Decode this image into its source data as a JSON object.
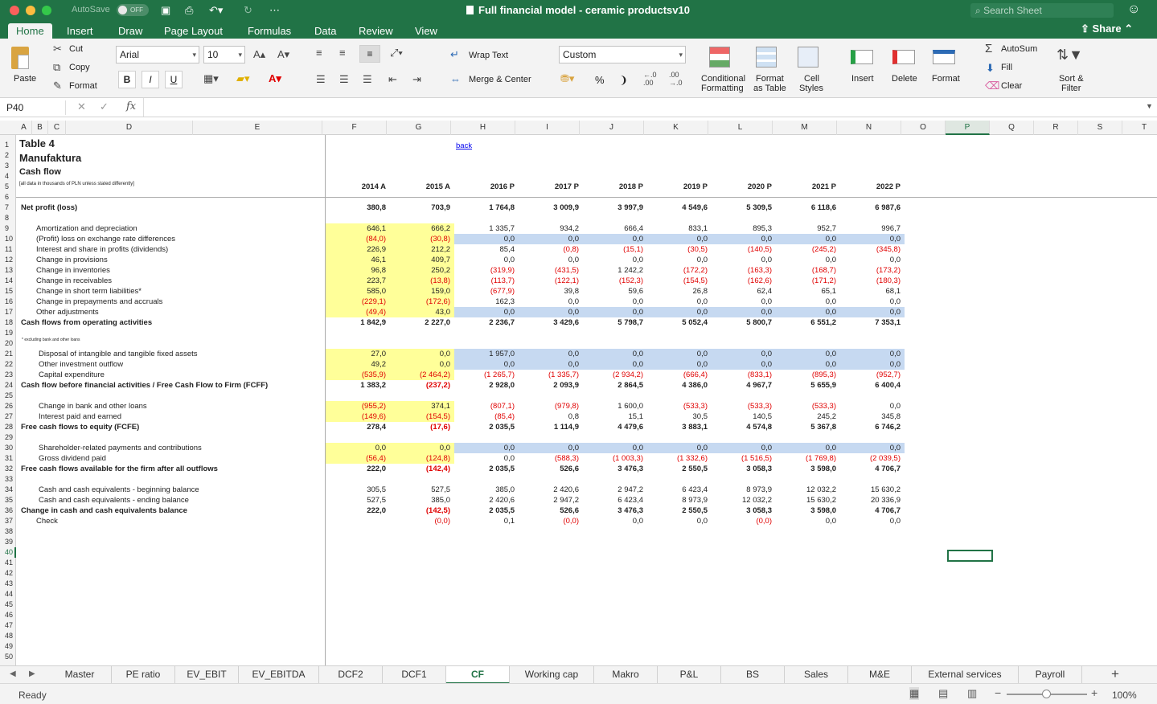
{
  "titlebar": {
    "autosave": "AutoSave",
    "autosave_state": "OFF",
    "doc_title": "Full financial model - ceramic productsv10",
    "search_placeholder": "Search Sheet"
  },
  "ribbon_tabs": [
    "Home",
    "Insert",
    "Draw",
    "Page Layout",
    "Formulas",
    "Data",
    "Review",
    "View"
  ],
  "share": "Share",
  "ribbon": {
    "paste": "Paste",
    "cut": "Cut",
    "copy": "Copy",
    "format_painter": "Format",
    "font_name": "Arial",
    "font_size": "10",
    "bold": "B",
    "italic": "I",
    "underline": "U",
    "wrap_text": "Wrap Text",
    "merge_center": "Merge & Center",
    "number_format": "Custom",
    "percent": "%",
    "comma": "❩",
    "cond_fmt_1": "Conditional",
    "cond_fmt_2": "Formatting",
    "fmt_table_1": "Format",
    "fmt_table_2": "as Table",
    "cell_styles_1": "Cell",
    "cell_styles_2": "Styles",
    "insert": "Insert",
    "delete": "Delete",
    "format": "Format",
    "autosum": "AutoSum",
    "fill": "Fill",
    "clear": "Clear",
    "sort_1": "Sort &",
    "sort_2": "Filter"
  },
  "formula_bar": {
    "name_box": "P40",
    "fx": "fx",
    "value": ""
  },
  "columns": [
    "A",
    "B",
    "C",
    "D",
    "E",
    "F",
    "G",
    "H",
    "I",
    "J",
    "K",
    "L",
    "M",
    "N",
    "O",
    "P",
    "Q",
    "R",
    "S",
    "T"
  ],
  "rows": [
    "1",
    "2",
    "3",
    "4",
    "5",
    "6",
    "7",
    "8",
    "9",
    "10",
    "11",
    "12",
    "13",
    "14",
    "15",
    "16",
    "17",
    "18",
    "19",
    "20",
    "21",
    "22",
    "23",
    "24",
    "25",
    "26",
    "27",
    "28",
    "29",
    "30",
    "31",
    "32",
    "33",
    "34",
    "35",
    "36",
    "37",
    "38",
    "39",
    "40",
    "41",
    "42",
    "43",
    "44",
    "45",
    "46",
    "47",
    "48",
    "49",
    "50"
  ],
  "sheet": {
    "title1": "Table 4",
    "title2": "Manufaktura",
    "title3": "Cash flow",
    "subnote": "[all data in thousands of PLN unless stated differently]",
    "back_link": "back",
    "footnote": "* excluding bank and other loans",
    "years": [
      "2014 A",
      "2015 A",
      "2016 P",
      "2017 P",
      "2018 P",
      "2019 P",
      "2020 P",
      "2021 P",
      "2022 P"
    ],
    "lines": [
      {
        "row": 7,
        "label": "Net profit (loss)",
        "bold": true,
        "indent": 0,
        "values": [
          "380,8",
          "703,9",
          "1 764,8",
          "3 009,9",
          "3 997,9",
          "4 549,6",
          "5 309,5",
          "6 118,6",
          "6 987,6"
        ]
      },
      {
        "row": 9,
        "label": "Amortization and depreciation",
        "indent": 1,
        "values": [
          "646,1",
          "666,2",
          "1 335,7",
          "934,2",
          "666,4",
          "833,1",
          "895,3",
          "952,7",
          "996,7"
        ]
      },
      {
        "row": 10,
        "label": "(Profit) loss on exchange rate differences",
        "indent": 1,
        "values": [
          "(84,0)",
          "(30,8)",
          "0,0",
          "0,0",
          "0,0",
          "0,0",
          "0,0",
          "0,0",
          "0,0"
        ]
      },
      {
        "row": 11,
        "label": "Interest and share in profits (dividends)",
        "indent": 1,
        "values": [
          "226,9",
          "212,2",
          "85,4",
          "(0,8)",
          "(15,1)",
          "(30,5)",
          "(140,5)",
          "(245,2)",
          "(345,8)"
        ]
      },
      {
        "row": 12,
        "label": "Change in provisions",
        "indent": 1,
        "values": [
          "46,1",
          "409,7",
          "0,0",
          "0,0",
          "0,0",
          "0,0",
          "0,0",
          "0,0",
          "0,0"
        ]
      },
      {
        "row": 13,
        "label": "Change in inventories",
        "indent": 1,
        "values": [
          "96,8",
          "250,2",
          "(319,9)",
          "(431,5)",
          "1 242,2",
          "(172,2)",
          "(163,3)",
          "(168,7)",
          "(173,2)"
        ]
      },
      {
        "row": 14,
        "label": "Change in receivables",
        "indent": 1,
        "values": [
          "223,7",
          "(13,8)",
          "(113,7)",
          "(122,1)",
          "(152,3)",
          "(154,5)",
          "(162,6)",
          "(171,2)",
          "(180,3)"
        ]
      },
      {
        "row": 15,
        "label": "Change in short term liabilities*",
        "indent": 1,
        "values": [
          "585,0",
          "159,0",
          "(677,9)",
          "39,8",
          "59,6",
          "26,8",
          "62,4",
          "65,1",
          "68,1"
        ]
      },
      {
        "row": 16,
        "label": "Change in prepayments and accruals",
        "indent": 1,
        "values": [
          "(229,1)",
          "(172,6)",
          "162,3",
          "0,0",
          "0,0",
          "0,0",
          "0,0",
          "0,0",
          "0,0"
        ]
      },
      {
        "row": 17,
        "label": "Other adjustments",
        "indent": 1,
        "values": [
          "(49,4)",
          "43,0",
          "0,0",
          "0,0",
          "0,0",
          "0,0",
          "0,0",
          "0,0",
          "0,0"
        ]
      },
      {
        "row": 18,
        "label": "Cash flows from operating activities",
        "bold": true,
        "indent": 0,
        "values": [
          "1 842,9",
          "2 227,0",
          "2 236,7",
          "3 429,6",
          "5 798,7",
          "5 052,4",
          "5 800,7",
          "6 551,2",
          "7 353,1"
        ]
      },
      {
        "row": 21,
        "label": "Disposal of intangible and tangible fixed assets",
        "indent": 2,
        "values": [
          "27,0",
          "0,0",
          "1 957,0",
          "0,0",
          "0,0",
          "0,0",
          "0,0",
          "0,0",
          "0,0"
        ]
      },
      {
        "row": 22,
        "label": "Other investment outflow",
        "indent": 2,
        "values": [
          "49,2",
          "0,0",
          "0,0",
          "0,0",
          "0,0",
          "0,0",
          "0,0",
          "0,0",
          "0,0"
        ]
      },
      {
        "row": 23,
        "label": "Capital expenditure",
        "indent": 2,
        "values": [
          "(535,9)",
          "(2 464,2)",
          "(1 265,7)",
          "(1 335,7)",
          "(2 934,2)",
          "(666,4)",
          "(833,1)",
          "(895,3)",
          "(952,7)"
        ]
      },
      {
        "row": 24,
        "label": "Cash flow before financial activities / Free Cash Flow to Firm (FCFF)",
        "bold": true,
        "indent": 0,
        "values": [
          "1 383,2",
          "(237,2)",
          "2 928,0",
          "2 093,9",
          "2 864,5",
          "4 386,0",
          "4 967,7",
          "5 655,9",
          "6 400,4"
        ]
      },
      {
        "row": 26,
        "label": "Change in bank and other loans",
        "indent": 2,
        "values": [
          "(955,2)",
          "374,1",
          "(807,1)",
          "(979,8)",
          "1 600,0",
          "(533,3)",
          "(533,3)",
          "(533,3)",
          "0,0"
        ]
      },
      {
        "row": 27,
        "label": "Interest paid and earned",
        "indent": 2,
        "values": [
          "(149,6)",
          "(154,5)",
          "(85,4)",
          "0,8",
          "15,1",
          "30,5",
          "140,5",
          "245,2",
          "345,8"
        ]
      },
      {
        "row": 28,
        "label": "Free cash flows to equity (FCFE)",
        "bold": true,
        "indent": 0,
        "values": [
          "278,4",
          "(17,6)",
          "2 035,5",
          "1 114,9",
          "4 479,6",
          "3 883,1",
          "4 574,8",
          "5 367,8",
          "6 746,2"
        ]
      },
      {
        "row": 30,
        "label": "Shareholder-related payments and contributions",
        "indent": 2,
        "values": [
          "0,0",
          "0,0",
          "0,0",
          "0,0",
          "0,0",
          "0,0",
          "0,0",
          "0,0",
          "0,0"
        ]
      },
      {
        "row": 31,
        "label": "Gross dividend paid",
        "indent": 2,
        "values": [
          "(56,4)",
          "(124,8)",
          "0,0",
          "(588,3)",
          "(1 003,3)",
          "(1 332,6)",
          "(1 516,5)",
          "(1 769,8)",
          "(2 039,5)"
        ]
      },
      {
        "row": 32,
        "label": "Free cash flows available for the firm after all outflows",
        "bold": true,
        "indent": 0,
        "values": [
          "222,0",
          "(142,4)",
          "2 035,5",
          "526,6",
          "3 476,3",
          "2 550,5",
          "3 058,3",
          "3 598,0",
          "4 706,7"
        ]
      },
      {
        "row": 34,
        "label": "Cash and cash equivalents - beginning balance",
        "indent": 2,
        "values": [
          "305,5",
          "527,5",
          "385,0",
          "2 420,6",
          "2 947,2",
          "6 423,4",
          "8 973,9",
          "12 032,2",
          "15 630,2"
        ]
      },
      {
        "row": 35,
        "label": "Cash and cash equivalents - ending balance",
        "indent": 2,
        "values": [
          "527,5",
          "385,0",
          "2 420,6",
          "2 947,2",
          "6 423,4",
          "8 973,9",
          "12 032,2",
          "15 630,2",
          "20 336,9"
        ]
      },
      {
        "row": 36,
        "label": "Change in cash and cash equivalents balance",
        "bold": true,
        "indent": 0,
        "values": [
          "222,0",
          "(142,5)",
          "2 035,5",
          "526,6",
          "3 476,3",
          "2 550,5",
          "3 058,3",
          "3 598,0",
          "4 706,7"
        ]
      },
      {
        "row": 37,
        "label": "Check",
        "indent": 1,
        "values": [
          "",
          "(0,0)",
          "0,1",
          "(0,0)",
          "0,0",
          "0,0",
          "(0,0)",
          "0,0",
          "0,0"
        ]
      }
    ]
  },
  "sheet_tabs": [
    "Master",
    "PE ratio",
    "EV_EBIT",
    "EV_EBITDA",
    "DCF2",
    "DCF1",
    "CF",
    "Working cap",
    "Makro",
    "P&L",
    "BS",
    "Sales",
    "M&E",
    "External services",
    "Payroll"
  ],
  "active_sheet": "CF",
  "status": {
    "ready": "Ready",
    "zoom": "100%"
  }
}
